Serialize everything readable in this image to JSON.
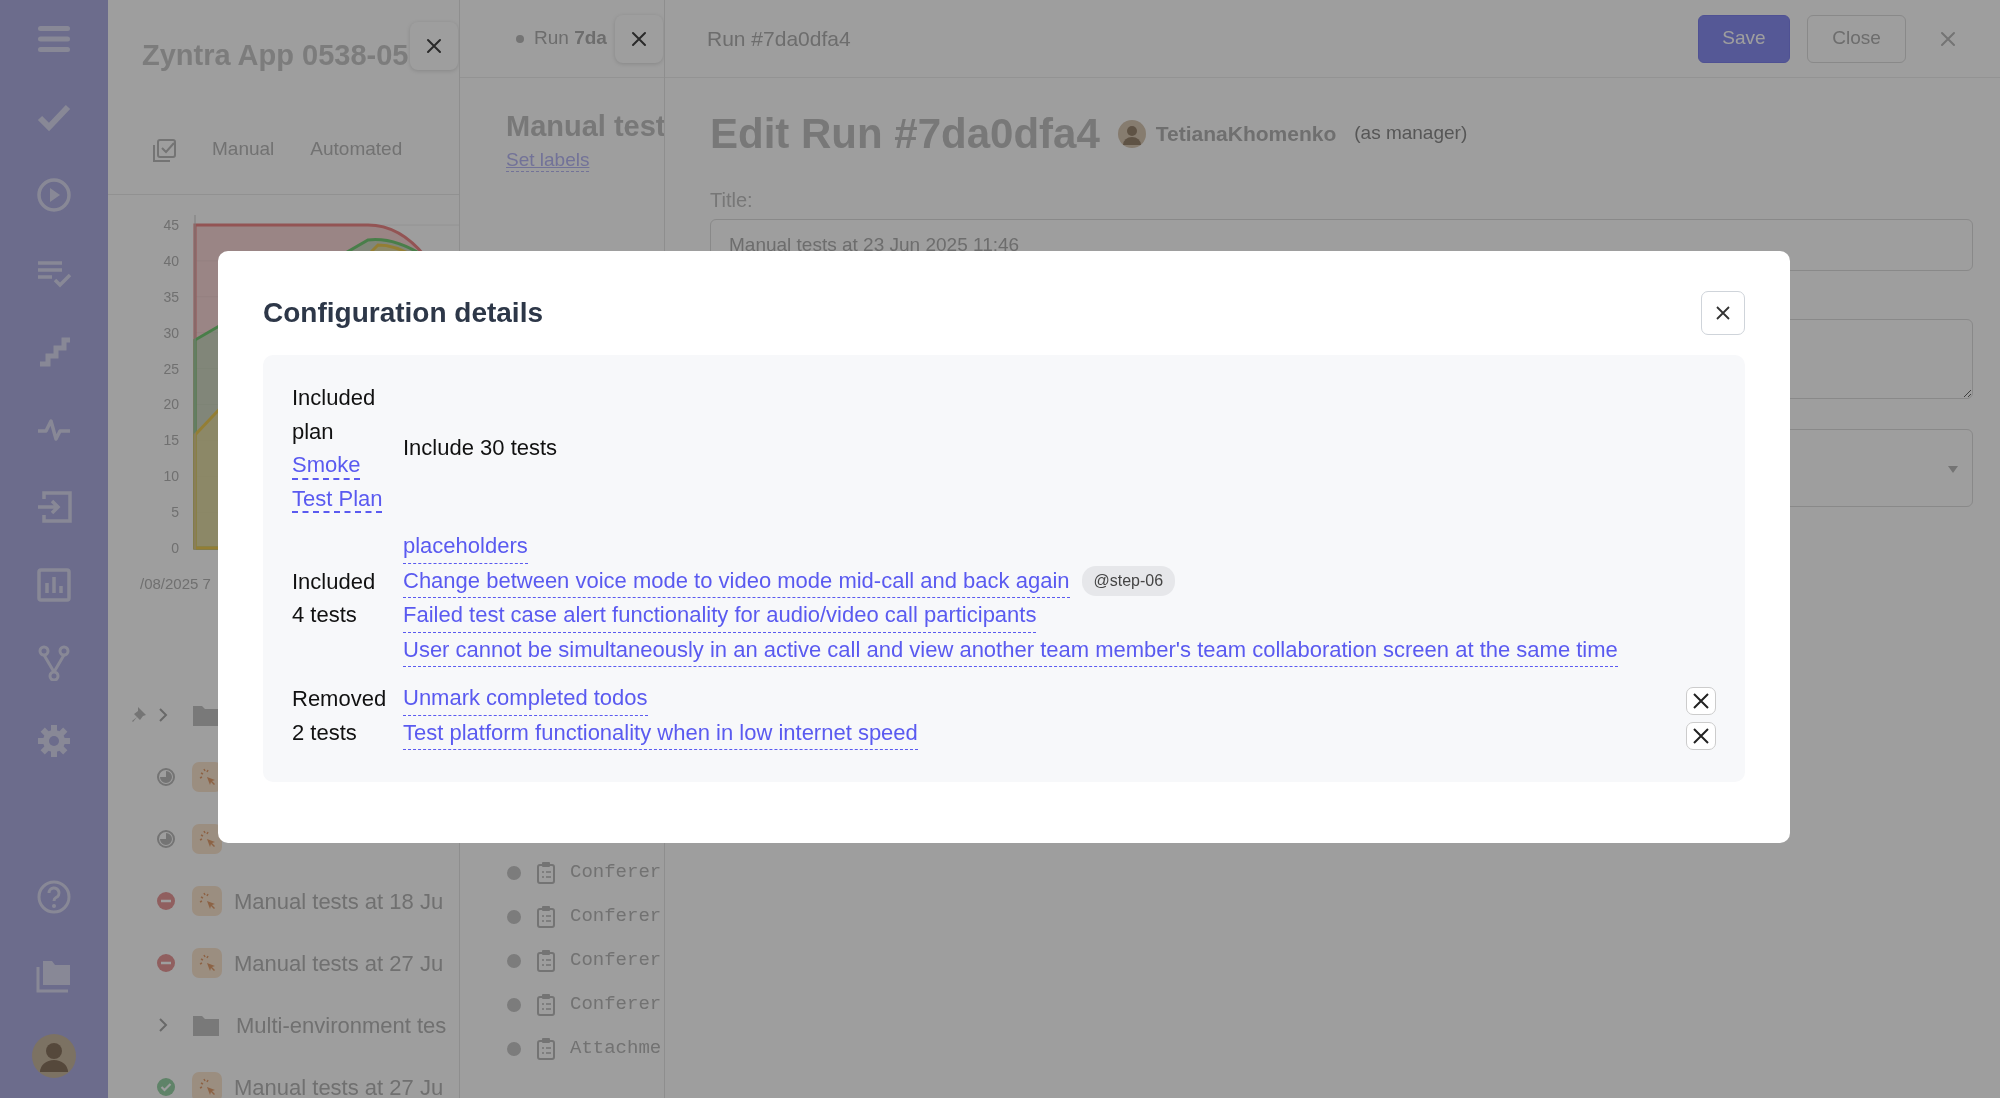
{
  "project_panel": {
    "title": "Zyntra App 0538-05",
    "tabs": [
      {
        "label": "Manual"
      },
      {
        "label": "Automated"
      }
    ],
    "chart": {
      "y_labels": [
        "45",
        "40",
        "35",
        "30",
        "25",
        "20",
        "15",
        "10",
        "5",
        "0"
      ],
      "x_label": "/08/2025 7"
    },
    "tree": [
      {
        "kind": "folder",
        "pinned": true
      },
      {
        "kind": "running",
        "pinned": false
      },
      {
        "kind": "running",
        "pinned": false
      },
      {
        "kind": "failed",
        "pinned": false,
        "label": "Manual tests at 18 Ju"
      },
      {
        "kind": "failed",
        "pinned": false,
        "label": "Manual tests at 27 Ju"
      },
      {
        "kind": "folder",
        "pinned": false,
        "label": "Multi-environment tes"
      },
      {
        "kind": "passed",
        "pinned": false,
        "label": "Manual tests at 27 Ju"
      }
    ]
  },
  "run_panel": {
    "tab": "Run **7da**",
    "title": "Manual test",
    "set_labels": "Set labels",
    "tests": [
      {
        "label": "Conferer"
      },
      {
        "label": "Conferer"
      },
      {
        "label": "Conferer"
      },
      {
        "label": "Conferer"
      },
      {
        "label": "Attachme"
      }
    ]
  },
  "edit_panel": {
    "header_title": "Run #7da0dfa4",
    "buttons": [
      {
        "label": "Save",
        "kind": "primary"
      },
      {
        "label": "Close",
        "kind": "secondary"
      }
    ],
    "heading": "Edit Run #7da0dfa4",
    "user": "TetianaKhomenko",
    "role": "(as manager)",
    "title_label": "Title:",
    "title_value": "Manual tests at 23 Jun 2025 11:46"
  },
  "modal": {
    "title": "Configuration details",
    "sections": [
      {
        "kind": "plan",
        "label": "Included plan",
        "link": "Smoke Test Plan",
        "text": "Include 30 tests"
      },
      {
        "kind": "included",
        "label": "Included 4 tests",
        "items": [
          {
            "title": "placeholders"
          },
          {
            "title": "Change between voice mode to video mode mid-call and back again",
            "tag": "@step-06"
          },
          {
            "title": "Failed test case alert functionality for audio/video call participants"
          },
          {
            "title": "User cannot be simultaneously in an active call and view another team member's team collaboration screen at the same time"
          }
        ]
      },
      {
        "kind": "removed",
        "label": "Removed 2 tests",
        "items": [
          {
            "title": "Unmark completed todos"
          },
          {
            "title": "Test platform functionality when in low internet speed"
          }
        ]
      }
    ]
  }
}
